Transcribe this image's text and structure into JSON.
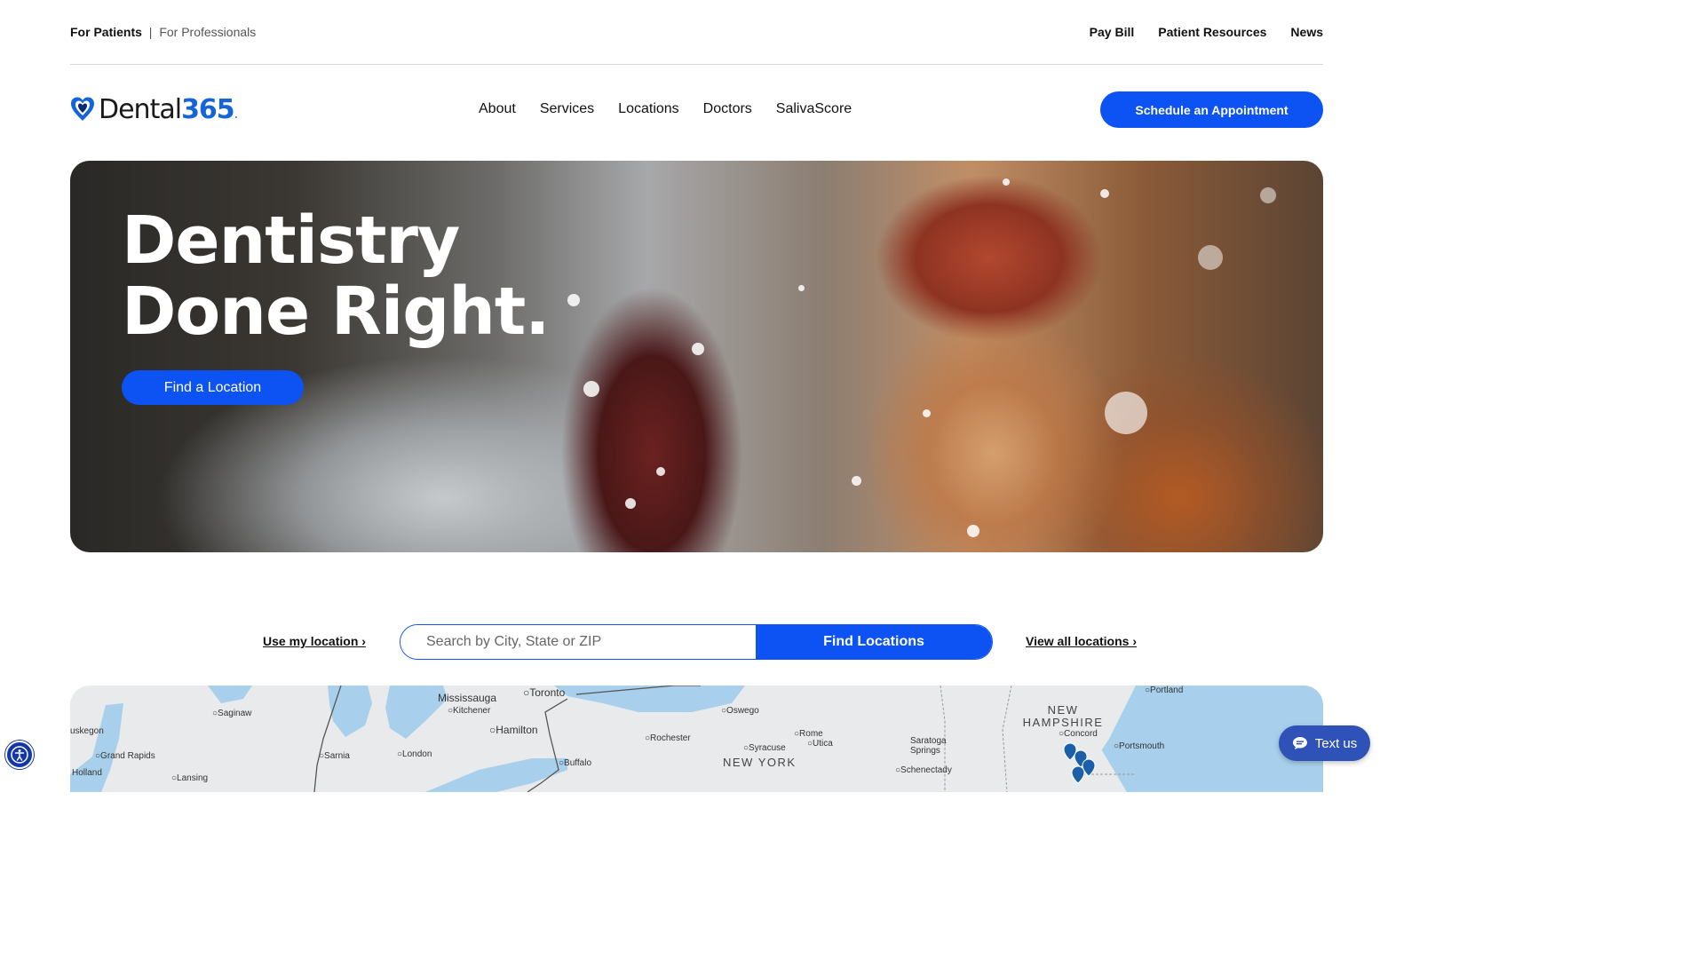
{
  "topbar": {
    "for_patients": "For Patients",
    "separator": "|",
    "for_professionals": "For Professionals",
    "links": [
      "Pay Bill",
      "Patient Resources",
      "News"
    ]
  },
  "brand": {
    "name_part": "Dental",
    "name_num": "365",
    "accent_color": "#0d52f2"
  },
  "nav": {
    "links": [
      "About",
      "Services",
      "Locations",
      "Doctors",
      "SalivaScore"
    ],
    "cta": "Schedule an Appointment"
  },
  "hero": {
    "line1": "Dentistry",
    "line2": "Done Right.",
    "button": "Find a Location"
  },
  "search": {
    "use_location": "Use my location ›",
    "placeholder": "Search by City, State or ZIP",
    "button": "Find Locations",
    "view_all": "View all locations ›"
  },
  "map": {
    "labels": [
      "Mississauga",
      "Toronto",
      "Kitchener",
      "Hamilton",
      "Saginaw",
      "uskegon",
      "Grand Rapids",
      "Holland",
      "Lansing",
      "Sarnia",
      "London",
      "Buffalo",
      "Rochester",
      "Oswego",
      "Syracuse",
      "Rome",
      "Utica",
      "Saratoga Springs",
      "Schenectady",
      "Concord",
      "Portsmouth",
      "Portland"
    ],
    "states": [
      "NEW YORK",
      "NEW HAMPSHIRE"
    ]
  },
  "widgets": {
    "accessibility_icon": "accessibility-icon",
    "text_us": "Text us"
  }
}
